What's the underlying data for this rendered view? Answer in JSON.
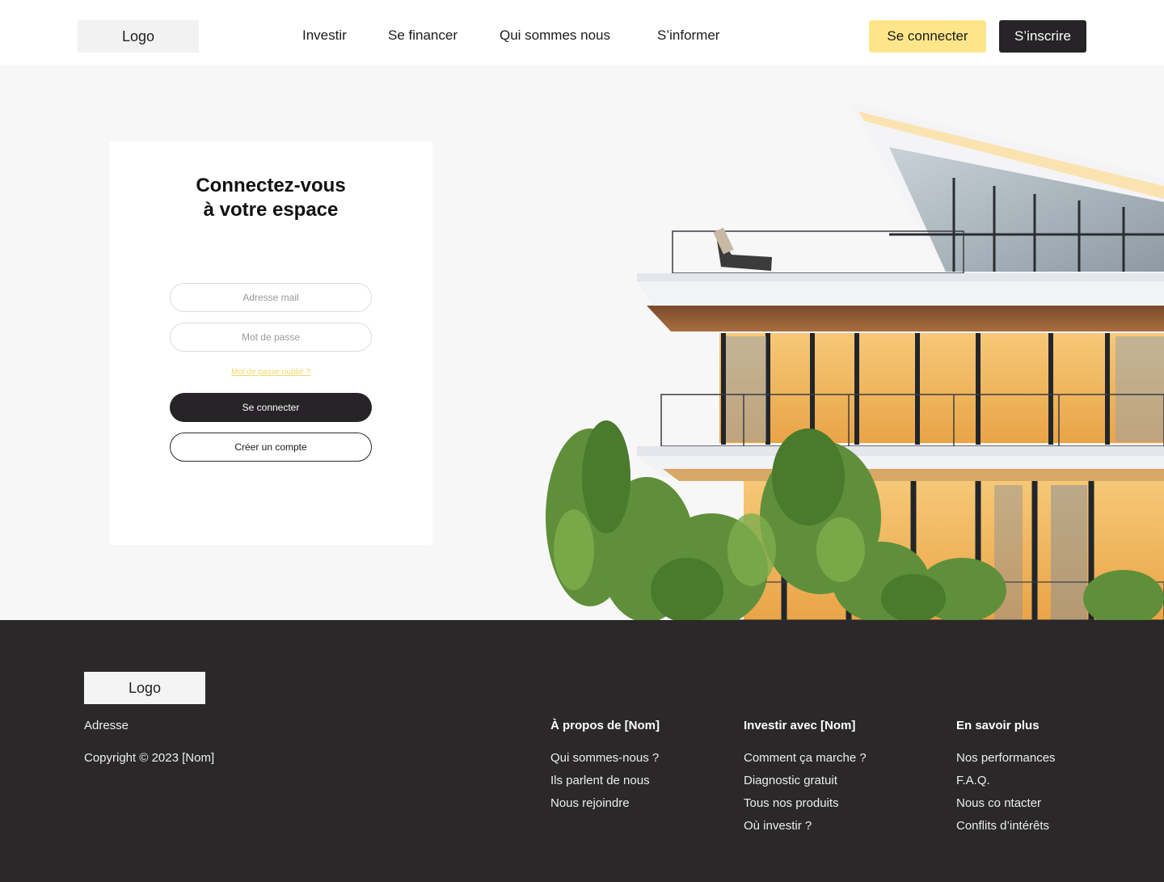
{
  "header": {
    "logo": "Logo",
    "nav": [
      "Investir",
      "Se financer",
      "Qui sommes nous",
      "S’informer"
    ],
    "login_button": "Se connecter",
    "signup_button": "S’inscrire"
  },
  "login_card": {
    "title_line1": "Connectez-vous",
    "title_line2": "à votre espace",
    "email_placeholder": "Adresse mail",
    "password_placeholder": "Mot de passe",
    "forgot_link": "Mot de passe oublié ?",
    "submit_button": "Se connecter",
    "create_account_button": "Créer un compte"
  },
  "footer": {
    "logo": "Logo",
    "address": "Adresse",
    "copyright": "Copyright © 2023 [Nom]",
    "columns": [
      {
        "heading": "À propos de [Nom]",
        "links": [
          "Qui sommes-nous ?",
          "Ils parlent de nous",
          "Nous rejoindre"
        ]
      },
      {
        "heading": "Investir avec [Nom]",
        "links": [
          "Comment ça marche ?",
          "Diagnostic gratuit",
          "Tous nos produits",
          "Où investir ?"
        ]
      },
      {
        "heading": "En savoir plus",
        "links": [
          "Nos performances",
          "F.A.Q.",
          "Nous co ntacter",
          "Conflits d’intérêts"
        ]
      }
    ]
  },
  "colors": {
    "accent_yellow": "#fde68a",
    "dark": "#262426",
    "footer_bg": "#2a2829"
  }
}
